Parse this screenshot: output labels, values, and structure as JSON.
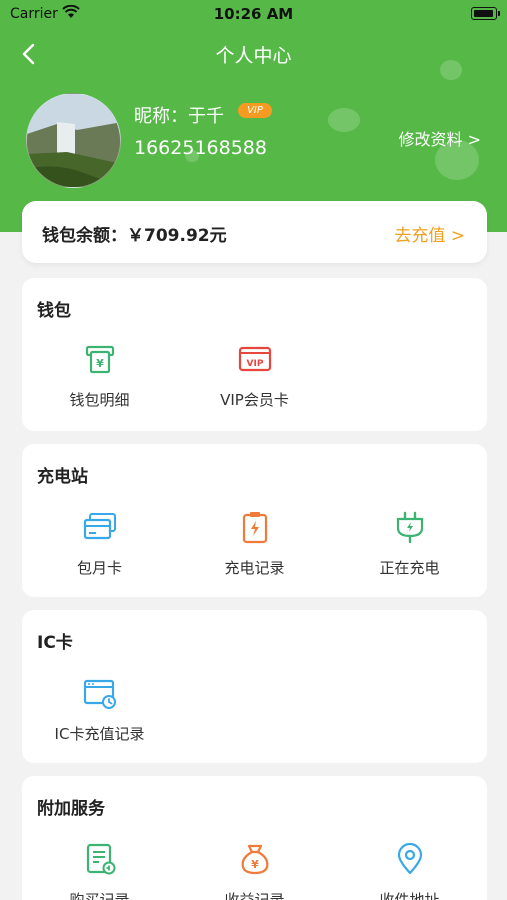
{
  "status_bar": {
    "carrier": "Carrier",
    "time": "10:26 AM"
  },
  "nav": {
    "title": "个人中心",
    "back_icon": "chevron-left-icon"
  },
  "profile": {
    "nickname": "昵称：于千",
    "vip_badge": "VIP",
    "phone": "16625168588",
    "edit_label": "修改资料 >"
  },
  "wallet": {
    "balance_label": "钱包余额：￥709.92元",
    "recharge_label": "去充值 >"
  },
  "sections": {
    "wallet": {
      "title": "钱包",
      "items": [
        {
          "label": "钱包明细",
          "icon": "wallet-detail-icon"
        },
        {
          "label": "VIP会员卡",
          "icon": "vip-card-icon"
        }
      ]
    },
    "charging": {
      "title": "充电站",
      "items": [
        {
          "label": "包月卡",
          "icon": "monthly-card-icon"
        },
        {
          "label": "充电记录",
          "icon": "charging-record-icon"
        },
        {
          "label": "正在充电",
          "icon": "plug-icon"
        }
      ]
    },
    "ic_card": {
      "title": "IC卡",
      "items": [
        {
          "label": "IC卡充值记录",
          "icon": "ic-recharge-record-icon"
        }
      ]
    },
    "extra": {
      "title": "附加服务",
      "items": [
        {
          "label": "购买记录",
          "icon": "purchase-record-icon"
        },
        {
          "label": "收益记录",
          "icon": "money-bag-icon"
        },
        {
          "label": "收件地址",
          "icon": "location-pin-icon"
        }
      ]
    }
  },
  "colors": {
    "brand_green": "#56b947",
    "accent_orange": "#f0a020",
    "icon_green": "#3cb371",
    "icon_red": "#e8453c",
    "icon_blue": "#38a8e8",
    "icon_orange": "#f07a3a"
  }
}
